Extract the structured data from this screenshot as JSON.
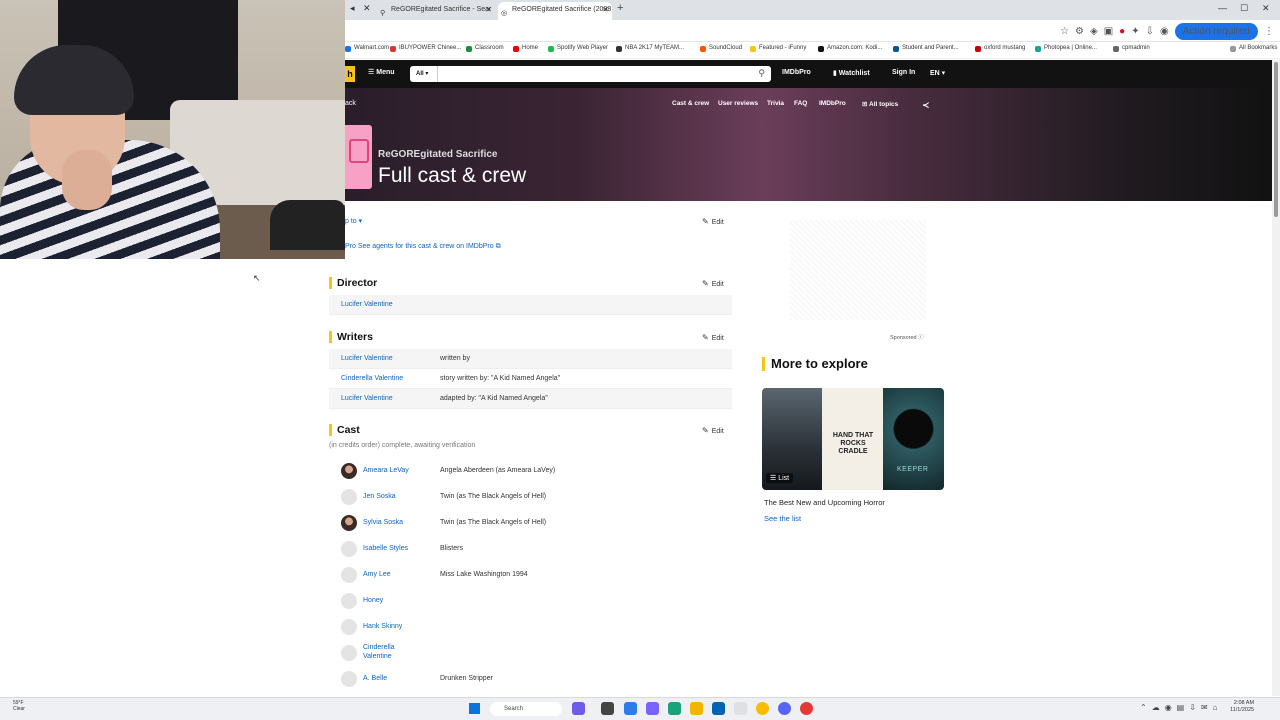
{
  "browser": {
    "tabs": [
      {
        "title": "ReGOREgitated Sacrifice - Sear",
        "active": false
      },
      {
        "title": "ReGOREgitated Sacrifice (2008",
        "active": true
      }
    ],
    "action_required": "Action required",
    "bookmarks": [
      {
        "label": "Walmart.com",
        "color": "#1a73e8"
      },
      {
        "label": "IBUYPOWER Chinee...",
        "color": "#d33"
      },
      {
        "label": "Classroom",
        "color": "#1e8e3e"
      },
      {
        "label": "Home",
        "color": "#e00"
      },
      {
        "label": "Spotify Web Player",
        "color": "#1db954"
      },
      {
        "label": "NBA 2K17 MyTEAM...",
        "color": "#333"
      },
      {
        "label": "SoundCloud",
        "color": "#f50"
      },
      {
        "label": "Featured - iFunny",
        "color": "#f5c518"
      },
      {
        "label": "Amazon.com: Kodi...",
        "color": "#111"
      },
      {
        "label": "Student and Parent...",
        "color": "#0b5394"
      },
      {
        "label": "oxford mustang",
        "color": "#c00"
      },
      {
        "label": "Photopea | Online...",
        "color": "#18a497"
      },
      {
        "label": "cpmadmin",
        "color": "#666"
      },
      {
        "label": "All Bookmarks",
        "color": "#999"
      }
    ]
  },
  "imdb": {
    "menu": "Menu",
    "search_category": "All",
    "nav": {
      "pro": "IMDbPro",
      "watchlist": "Watchlist",
      "signin": "Sign In",
      "lang": "EN"
    },
    "back": "ack",
    "subnav": [
      "Cast & crew",
      "User reviews",
      "Trivia",
      "FAQ",
      "IMDbPro",
      "All topics"
    ],
    "movie_title": "ReGOREgitated Sacrifice",
    "page_heading": "Full cast & crew",
    "jump_to": "p to",
    "edit": "Edit",
    "agents_link": "See agents for this cast & crew on IMDbPro"
  },
  "director": {
    "title": "Director",
    "rows": [
      {
        "name": "Lucifer Valentine",
        "role": ""
      }
    ]
  },
  "writers": {
    "title": "Writers",
    "rows": [
      {
        "name": "Lucifer Valentine",
        "role": "written by"
      },
      {
        "name": "Cinderella Valentine",
        "role": "story written by: \"A Kid Named Angela\""
      },
      {
        "name": "Lucifer Valentine",
        "role": "adapted by: \"A Kid Named Angela\""
      }
    ]
  },
  "cast": {
    "title": "Cast",
    "note": "(in credits order) complete, awaiting verification",
    "rows": [
      {
        "name": "Ameara LeVay",
        "role": "Angela Aberdeen (as Ameara LaVey)",
        "photo": true
      },
      {
        "name": "Jen Soska",
        "role": "Twin (as The Black Angels of Hell)",
        "photo": false
      },
      {
        "name": "Sylvia Soska",
        "role": "Twin (as The Black Angels of Hell)",
        "photo": true
      },
      {
        "name": "Isabelle Styles",
        "role": "Blisters",
        "photo": false
      },
      {
        "name": "Amy Lee",
        "role": "Miss Lake Washington 1994",
        "photo": false
      },
      {
        "name": "Honey",
        "role": "",
        "photo": false
      },
      {
        "name": "Hank Skinny",
        "role": "",
        "photo": false
      },
      {
        "name": "Cinderella Valentine",
        "role": "",
        "photo": false
      },
      {
        "name": "A. Belle",
        "role": "Drunken Stripper",
        "photo": false
      }
    ]
  },
  "sidebar": {
    "sponsored": "Sponsored",
    "explore_title": "More to explore",
    "poster2_text": "HAND THAT ROCKS CRADLE",
    "poster3_text": "KEEPER",
    "list_badge": "List",
    "caption": "The Best New and Upcoming Horror",
    "see_list": "See the list"
  },
  "taskbar": {
    "weather_temp": "59°F",
    "weather_desc": "Clear",
    "search": "Search",
    "time": "2:08 AM",
    "date": "11/1/2025"
  }
}
